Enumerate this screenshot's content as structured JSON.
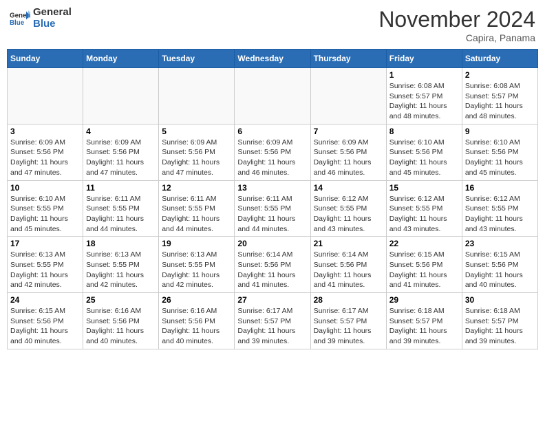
{
  "logo": {
    "general": "General",
    "blue": "Blue"
  },
  "header": {
    "month": "November 2024",
    "location": "Capira, Panama"
  },
  "weekdays": [
    "Sunday",
    "Monday",
    "Tuesday",
    "Wednesday",
    "Thursday",
    "Friday",
    "Saturday"
  ],
  "weeks": [
    [
      {
        "day": "",
        "info": ""
      },
      {
        "day": "",
        "info": ""
      },
      {
        "day": "",
        "info": ""
      },
      {
        "day": "",
        "info": ""
      },
      {
        "day": "",
        "info": ""
      },
      {
        "day": "1",
        "info": "Sunrise: 6:08 AM\nSunset: 5:57 PM\nDaylight: 11 hours\nand 48 minutes."
      },
      {
        "day": "2",
        "info": "Sunrise: 6:08 AM\nSunset: 5:57 PM\nDaylight: 11 hours\nand 48 minutes."
      }
    ],
    [
      {
        "day": "3",
        "info": "Sunrise: 6:09 AM\nSunset: 5:56 PM\nDaylight: 11 hours\nand 47 minutes."
      },
      {
        "day": "4",
        "info": "Sunrise: 6:09 AM\nSunset: 5:56 PM\nDaylight: 11 hours\nand 47 minutes."
      },
      {
        "day": "5",
        "info": "Sunrise: 6:09 AM\nSunset: 5:56 PM\nDaylight: 11 hours\nand 47 minutes."
      },
      {
        "day": "6",
        "info": "Sunrise: 6:09 AM\nSunset: 5:56 PM\nDaylight: 11 hours\nand 46 minutes."
      },
      {
        "day": "7",
        "info": "Sunrise: 6:09 AM\nSunset: 5:56 PM\nDaylight: 11 hours\nand 46 minutes."
      },
      {
        "day": "8",
        "info": "Sunrise: 6:10 AM\nSunset: 5:56 PM\nDaylight: 11 hours\nand 45 minutes."
      },
      {
        "day": "9",
        "info": "Sunrise: 6:10 AM\nSunset: 5:56 PM\nDaylight: 11 hours\nand 45 minutes."
      }
    ],
    [
      {
        "day": "10",
        "info": "Sunrise: 6:10 AM\nSunset: 5:55 PM\nDaylight: 11 hours\nand 45 minutes."
      },
      {
        "day": "11",
        "info": "Sunrise: 6:11 AM\nSunset: 5:55 PM\nDaylight: 11 hours\nand 44 minutes."
      },
      {
        "day": "12",
        "info": "Sunrise: 6:11 AM\nSunset: 5:55 PM\nDaylight: 11 hours\nand 44 minutes."
      },
      {
        "day": "13",
        "info": "Sunrise: 6:11 AM\nSunset: 5:55 PM\nDaylight: 11 hours\nand 44 minutes."
      },
      {
        "day": "14",
        "info": "Sunrise: 6:12 AM\nSunset: 5:55 PM\nDaylight: 11 hours\nand 43 minutes."
      },
      {
        "day": "15",
        "info": "Sunrise: 6:12 AM\nSunset: 5:55 PM\nDaylight: 11 hours\nand 43 minutes."
      },
      {
        "day": "16",
        "info": "Sunrise: 6:12 AM\nSunset: 5:55 PM\nDaylight: 11 hours\nand 43 minutes."
      }
    ],
    [
      {
        "day": "17",
        "info": "Sunrise: 6:13 AM\nSunset: 5:55 PM\nDaylight: 11 hours\nand 42 minutes."
      },
      {
        "day": "18",
        "info": "Sunrise: 6:13 AM\nSunset: 5:55 PM\nDaylight: 11 hours\nand 42 minutes."
      },
      {
        "day": "19",
        "info": "Sunrise: 6:13 AM\nSunset: 5:55 PM\nDaylight: 11 hours\nand 42 minutes."
      },
      {
        "day": "20",
        "info": "Sunrise: 6:14 AM\nSunset: 5:56 PM\nDaylight: 11 hours\nand 41 minutes."
      },
      {
        "day": "21",
        "info": "Sunrise: 6:14 AM\nSunset: 5:56 PM\nDaylight: 11 hours\nand 41 minutes."
      },
      {
        "day": "22",
        "info": "Sunrise: 6:15 AM\nSunset: 5:56 PM\nDaylight: 11 hours\nand 41 minutes."
      },
      {
        "day": "23",
        "info": "Sunrise: 6:15 AM\nSunset: 5:56 PM\nDaylight: 11 hours\nand 40 minutes."
      }
    ],
    [
      {
        "day": "24",
        "info": "Sunrise: 6:15 AM\nSunset: 5:56 PM\nDaylight: 11 hours\nand 40 minutes."
      },
      {
        "day": "25",
        "info": "Sunrise: 6:16 AM\nSunset: 5:56 PM\nDaylight: 11 hours\nand 40 minutes."
      },
      {
        "day": "26",
        "info": "Sunrise: 6:16 AM\nSunset: 5:56 PM\nDaylight: 11 hours\nand 40 minutes."
      },
      {
        "day": "27",
        "info": "Sunrise: 6:17 AM\nSunset: 5:57 PM\nDaylight: 11 hours\nand 39 minutes."
      },
      {
        "day": "28",
        "info": "Sunrise: 6:17 AM\nSunset: 5:57 PM\nDaylight: 11 hours\nand 39 minutes."
      },
      {
        "day": "29",
        "info": "Sunrise: 6:18 AM\nSunset: 5:57 PM\nDaylight: 11 hours\nand 39 minutes."
      },
      {
        "day": "30",
        "info": "Sunrise: 6:18 AM\nSunset: 5:57 PM\nDaylight: 11 hours\nand 39 minutes."
      }
    ]
  ]
}
